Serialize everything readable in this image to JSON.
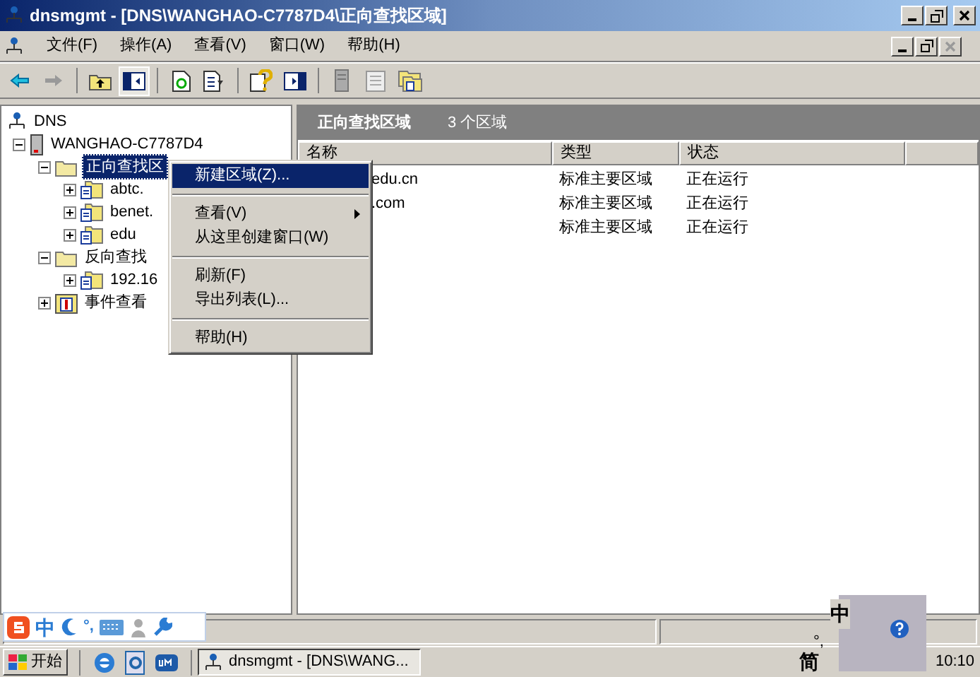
{
  "window": {
    "title": "dnsmgmt - [DNS\\WANGHAO-C7787D4\\正向查找区域]"
  },
  "menu": [
    "文件(F)",
    "操作(A)",
    "查看(V)",
    "窗口(W)",
    "帮助(H)"
  ],
  "tree": [
    {
      "label": "DNS",
      "kind": "dns",
      "selected": false,
      "children": [
        {
          "label": "WANGHAO-C7787D4",
          "kind": "server",
          "expanded": true,
          "selected": false,
          "children": [
            {
              "label": "正向查找区",
              "kind": "folder",
              "expanded": true,
              "selected": true,
              "children": [
                {
                  "label": "abtc.",
                  "kind": "zone",
                  "expanded": false,
                  "selected": false
                },
                {
                  "label": "benet.",
                  "kind": "zone",
                  "expanded": false,
                  "selected": false
                },
                {
                  "label": "edu",
                  "kind": "zone",
                  "expanded": false,
                  "selected": false
                }
              ]
            },
            {
              "label": "反向查找",
              "kind": "folder",
              "expanded": true,
              "selected": false,
              "children": [
                {
                  "label": "192.16",
                  "kind": "zone",
                  "expanded": false,
                  "selected": false
                }
              ]
            },
            {
              "label": "事件查看",
              "kind": "log",
              "expanded": false,
              "selected": false
            }
          ]
        }
      ]
    }
  ],
  "context_menu": [
    {
      "kind": "item",
      "label": "新建区域(Z)...",
      "selected": true,
      "submenu": false
    },
    {
      "kind": "separator"
    },
    {
      "kind": "item",
      "label": "查看(V)",
      "selected": false,
      "submenu": true
    },
    {
      "kind": "item",
      "label": "从这里创建窗口(W)",
      "selected": false,
      "submenu": false
    },
    {
      "kind": "separator"
    },
    {
      "kind": "item",
      "label": "刷新(F)",
      "selected": false,
      "submenu": false
    },
    {
      "kind": "item",
      "label": "导出列表(L)...",
      "selected": false,
      "submenu": false
    },
    {
      "kind": "separator"
    },
    {
      "kind": "item",
      "label": "帮助(H)",
      "selected": false,
      "submenu": false
    }
  ],
  "pane": {
    "title": "正向查找区域",
    "count": "3 个区域"
  },
  "table": {
    "columns": [
      "名称",
      "类型",
      "状态"
    ],
    "rows": [
      {
        "name": "edu.cn",
        "type": "标准主要区域",
        "status": "正在运行"
      },
      {
        "name": ".com",
        "type": "标准主要区域",
        "status": "正在运行"
      },
      {
        "type": "标准主要区域",
        "status": "正在运行"
      }
    ]
  },
  "ime": {
    "mode": "中",
    "punct": "°,"
  },
  "taskbar": {
    "start": "开始",
    "task": "dnsmgmt - [DNS\\WANG...",
    "tray_mode": "中",
    "tray_script": "简",
    "tray_punct": "°,",
    "clock": "10:10"
  }
}
